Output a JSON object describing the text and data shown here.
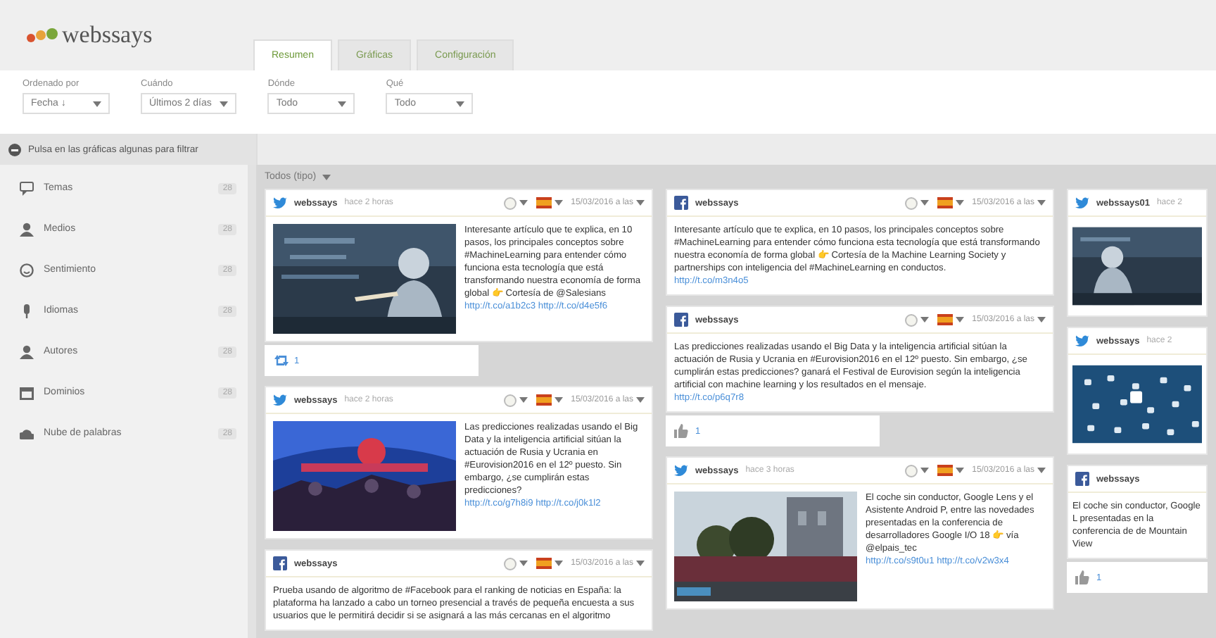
{
  "logo": {
    "text": "webssays"
  },
  "tabs": [
    {
      "label": "Resumen",
      "selected": true
    },
    {
      "label": "Gráficas",
      "selected": false
    },
    {
      "label": "Configuración",
      "selected": false
    }
  ],
  "filters": [
    {
      "label": "Ordenado por",
      "value": "Fecha ↓"
    },
    {
      "label": "Cuándo",
      "value": "Últimos 2 días"
    },
    {
      "label": "Dónde",
      "value": "Todo"
    },
    {
      "label": "Qué",
      "value": "Todo"
    }
  ],
  "hint": "Pulsa en las gráficas algunas para filtrar",
  "sidebar": {
    "items": [
      {
        "label": "Temas",
        "count": "28"
      },
      {
        "label": "Medios",
        "count": "28"
      },
      {
        "label": "Sentimiento",
        "count": "28"
      },
      {
        "label": "Idiomas",
        "count": "28"
      },
      {
        "label": "Autores",
        "count": "28"
      },
      {
        "label": "Dominios",
        "count": "28"
      },
      {
        "label": "Nube de palabras",
        "count": "28"
      }
    ]
  },
  "feed_title": "Todos (tipo)",
  "columns": [
    [
      {
        "kind": "twitter",
        "author": "webssays",
        "time": "hace 2 horas",
        "date": "15/03/2016 a las",
        "text": "Interesante artículo que te explica, en 10 pasos, los principales conceptos sobre #MachineLearning para entender cómo funciona esta tecnología que está transformando nuestra economía de forma global 👉 Cortesía de @Salesians",
        "link": "http://t.co/a1b2c3 http://t.co/d4e5f6",
        "footer": {
          "kind": "retweet",
          "count": "1"
        }
      },
      {
        "kind": "twitter",
        "author": "webssays",
        "time": "hace 2 horas",
        "date": "15/03/2016 a las",
        "text": "Las predicciones realizadas usando el Big Data y la inteligencia artificial sitúan la actuación de Rusia y Ucrania en #Eurovision2016 en el 12º puesto. Sin embargo, ¿se cumplirán estas predicciones?",
        "link": "http://t.co/g7h8i9 http://t.co/j0k1l2"
      },
      {
        "kind": "facebook",
        "author": "webssays",
        "date": "15/03/2016 a las",
        "text": "Prueba usando de algoritmo de #Facebook para el ranking de noticias en España: la plataforma ha lanzado a cabo un torneo presencial a través de pequeña encuesta a sus usuarios que le permitirá decidir si se asignará a las más cercanas en el algoritmo"
      }
    ],
    [
      {
        "kind": "facebook",
        "author": "webssays",
        "date": "15/03/2016 a las",
        "text": "Interesante artículo que te explica, en 10 pasos, los principales conceptos sobre #MachineLearning para entender cómo funciona esta tecnología que está transformando nuestra economía de forma global 👉 Cortesía de la Machine Learning Society y partnerships con inteligencia del #MachineLearning en conductos.",
        "link": "http://t.co/m3n4o5"
      },
      {
        "kind": "facebook",
        "author": "webssays",
        "date": "15/03/2016 a las",
        "text": "Las predicciones realizadas usando el Big Data y la inteligencia artificial sitúan la actuación de Rusia y Ucrania en #Eurovision2016 en el 12º puesto. Sin embargo, ¿se cumplirán estas predicciones? ganará el Festival de Eurovision según la inteligencia artificial con machine learning y los resultados en el mensaje.",
        "link": "http://t.co/p6q7r8",
        "footer": {
          "kind": "like",
          "count": "1"
        }
      },
      {
        "kind": "twitter",
        "author": "webssays",
        "time": "hace 3 horas",
        "date": "15/03/2016 a las",
        "text": "El coche sin conductor, Google Lens y el Asistente Android P, entre las novedades presentadas en la conferencia de desarrolladores Google I/O 18 👉 vía @elpais_tec",
        "link": "http://t.co/s9t0u1 http://t.co/v2w3x4"
      }
    ],
    [
      {
        "kind": "twitter",
        "author": "webssays01",
        "time": "hace 2"
      },
      {
        "kind": "twitter",
        "author": "webssays",
        "time": "hace 2"
      },
      {
        "kind": "facebook",
        "author": "webssays",
        "text": "El coche sin conductor, Google L presentadas en la conferencia de de Mountain View",
        "footer": {
          "kind": "like",
          "count": "1"
        }
      }
    ]
  ]
}
